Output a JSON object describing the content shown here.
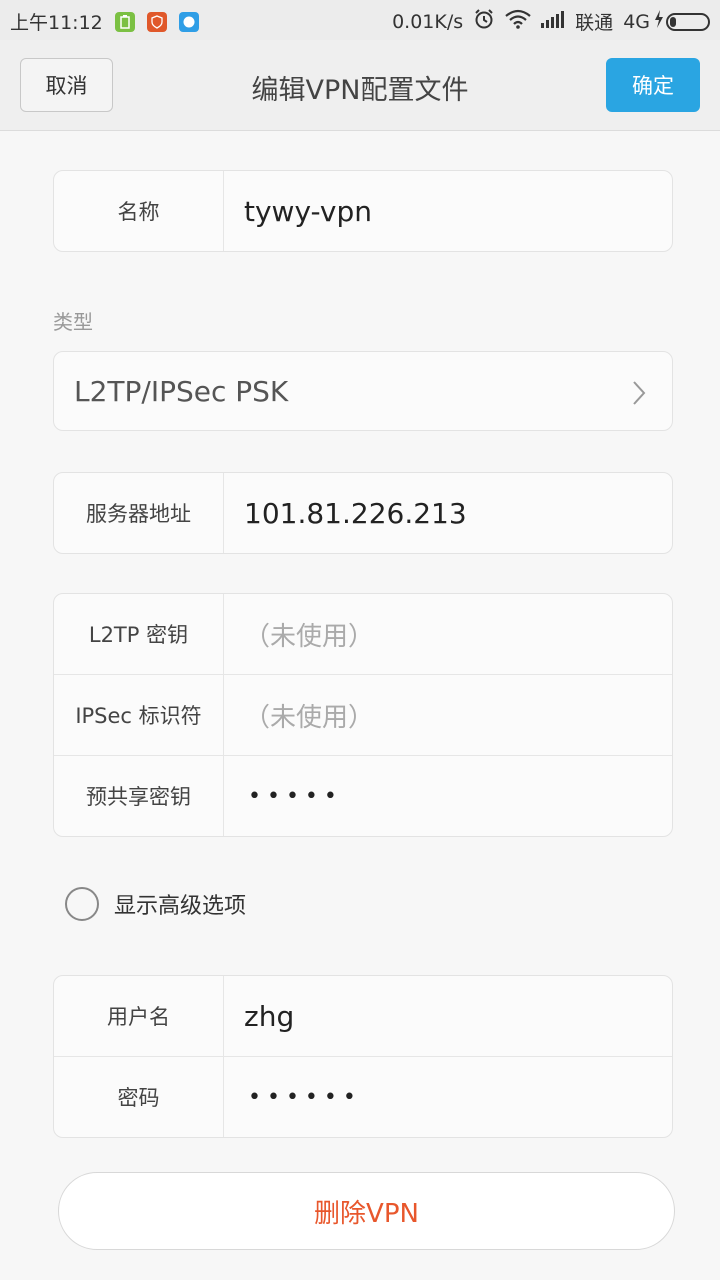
{
  "status_bar": {
    "time": "上午11:12",
    "app_icons": [
      "battery-app-icon",
      "shield-app-icon",
      "browser-app-icon"
    ],
    "net_speed": "0.01K/s",
    "carrier": "联通",
    "network": "4G"
  },
  "header": {
    "cancel_label": "取消",
    "title": "编辑VPN配置文件",
    "confirm_label": "确定"
  },
  "name_row": {
    "label": "名称",
    "value": "tywy-vpn"
  },
  "type_section": {
    "label": "类型",
    "value": "L2TP/IPSec PSK"
  },
  "server_row": {
    "label": "服务器地址",
    "value": "101.81.226.213"
  },
  "security": {
    "l2tp_key": {
      "label": "L2TP 密钥",
      "placeholder": "（未使用）"
    },
    "ipsec_id": {
      "label": "IPSec 标识符",
      "placeholder": "（未使用）"
    },
    "psk": {
      "label": "预共享密钥",
      "value": "•••••"
    }
  },
  "advanced": {
    "label": "显示高级选项",
    "checked": false
  },
  "credentials": {
    "username": {
      "label": "用户名",
      "value": "zhg"
    },
    "password": {
      "label": "密码",
      "value": "••••••"
    }
  },
  "delete_label": "删除VPN",
  "colors": {
    "accent": "#2aa5e2",
    "danger": "#e8572c"
  }
}
